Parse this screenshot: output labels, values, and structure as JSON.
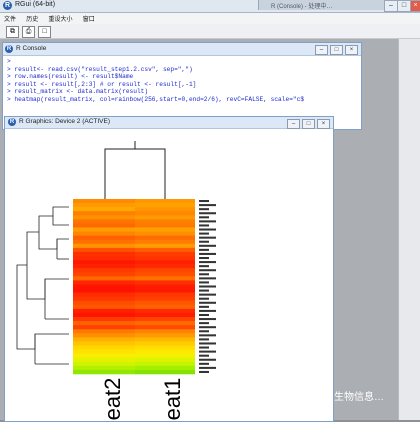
{
  "app": {
    "title": "RGui (64-bit)",
    "faded_window_title": "R (Console) - 处理中…"
  },
  "menu": [
    "文件",
    "历史",
    "重设大小",
    "窗口"
  ],
  "console": {
    "title": "R Console",
    "lines": [
      ">",
      "> result<- read.csv(\"result_step1.2.csv\", sep=\",\")",
      "> row.names(result) <- result$Name",
      "> result <- result[,2:3] # or result <- result[,-1]",
      "> result_matrix <- data.matrix(result)",
      "> heatmap(result_matrix, col=rainbow(256,start=0,end=2/6), revC=FALSE, scale=\"c$"
    ]
  },
  "graphics": {
    "title": "R Graphics: Device 2 (ACTIVE)",
    "column_labels": [
      "eat2",
      "eat1"
    ]
  },
  "chart_data": {
    "type": "heatmap",
    "columns": [
      "eat2",
      "eat1"
    ],
    "colormap": "rainbow(256, start=0, end=2/6)",
    "row_colors_col1": [
      "#ff8a00",
      "#ff9a00",
      "#ffa800",
      "#ff8000",
      "#ff9000",
      "#ff7400",
      "#ff6a00",
      "#ff9c00",
      "#ff8400",
      "#ff6000",
      "#ff7000",
      "#ff9400",
      "#ff5000",
      "#ff3000",
      "#ff2a00",
      "#ff1800",
      "#ff2000",
      "#ff3a00",
      "#ff4400",
      "#ff6800",
      "#ff2600",
      "#ff1400",
      "#ff1000",
      "#ff2c00",
      "#ff3600",
      "#ff4c00",
      "#ff5800",
      "#ff2000",
      "#ff1400",
      "#ff3a00",
      "#ff6000",
      "#ff4000",
      "#ff7800",
      "#ff9000",
      "#ffb000",
      "#ffc400",
      "#ffd800",
      "#ffe200",
      "#f8ee00",
      "#e4f200",
      "#d0f400",
      "#b0f000",
      "#90e800"
    ],
    "row_colors_col2": [
      "#ff9800",
      "#ffa200",
      "#ff9400",
      "#ff8800",
      "#ff9a00",
      "#ff8000",
      "#ff7a00",
      "#ffa000",
      "#ff8e00",
      "#ff6c00",
      "#ff7c00",
      "#ff9c00",
      "#ff5c00",
      "#ff3c00",
      "#ff3400",
      "#ff2000",
      "#ff2800",
      "#ff4600",
      "#ff5000",
      "#ff7000",
      "#ff3000",
      "#ff1c00",
      "#ff1800",
      "#ff3600",
      "#ff4000",
      "#ff5600",
      "#ff6200",
      "#ff2a00",
      "#ff1c00",
      "#ff4400",
      "#ff6a00",
      "#ff4a00",
      "#ff8200",
      "#ff9a00",
      "#ffb800",
      "#ffcc00",
      "#ffde00",
      "#ffe800",
      "#f4f000",
      "#dcf400",
      "#c4f400",
      "#a4ee00",
      "#84e400"
    ]
  },
  "watermark": "生物信息…"
}
